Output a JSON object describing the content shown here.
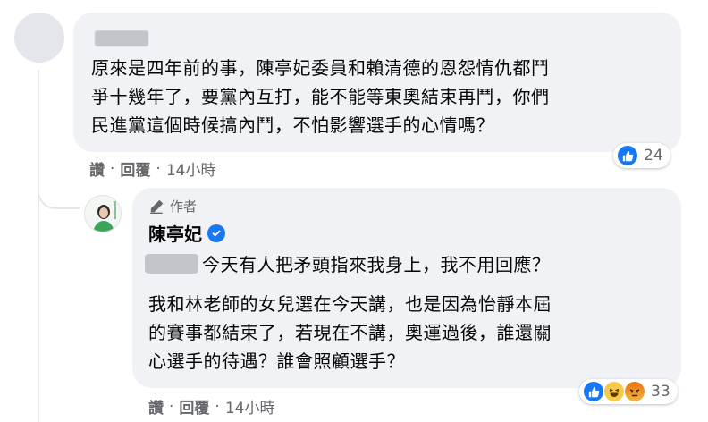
{
  "comment1": {
    "text": "原來是四年前的事，陳亭妃委員和賴清德的恩怨情仇都鬥\n爭十幾年了，要黨內互打，能不能等東奧結束再鬥，你們\n民進黨這個時候搞內鬥，不怕影響選手的心情嗎？",
    "reaction_count": "24",
    "actions": {
      "like": "讚",
      "reply": "回覆",
      "time": "14小時"
    }
  },
  "reply": {
    "author_badge": "作者",
    "name": "陳亭妃",
    "first_line": "今天有人把矛頭指來我身上，我不用回應？",
    "text": "我和林老師的女兒選在今天講，也是因為怡靜本屆\n的賽事都結束了，若現在不講，奧運過後，誰還關\n心選手的待遇？誰會照顧選手？",
    "reaction_count": "33",
    "reaction_icons": [
      "like-icon",
      "haha-icon",
      "angry-icon"
    ],
    "actions": {
      "like": "讚",
      "reply": "回覆",
      "time": "14小時"
    }
  },
  "separator": "·",
  "colors": {
    "like": "#1877f2",
    "bubble": "#f0f2f5",
    "meta": "#65676b"
  }
}
